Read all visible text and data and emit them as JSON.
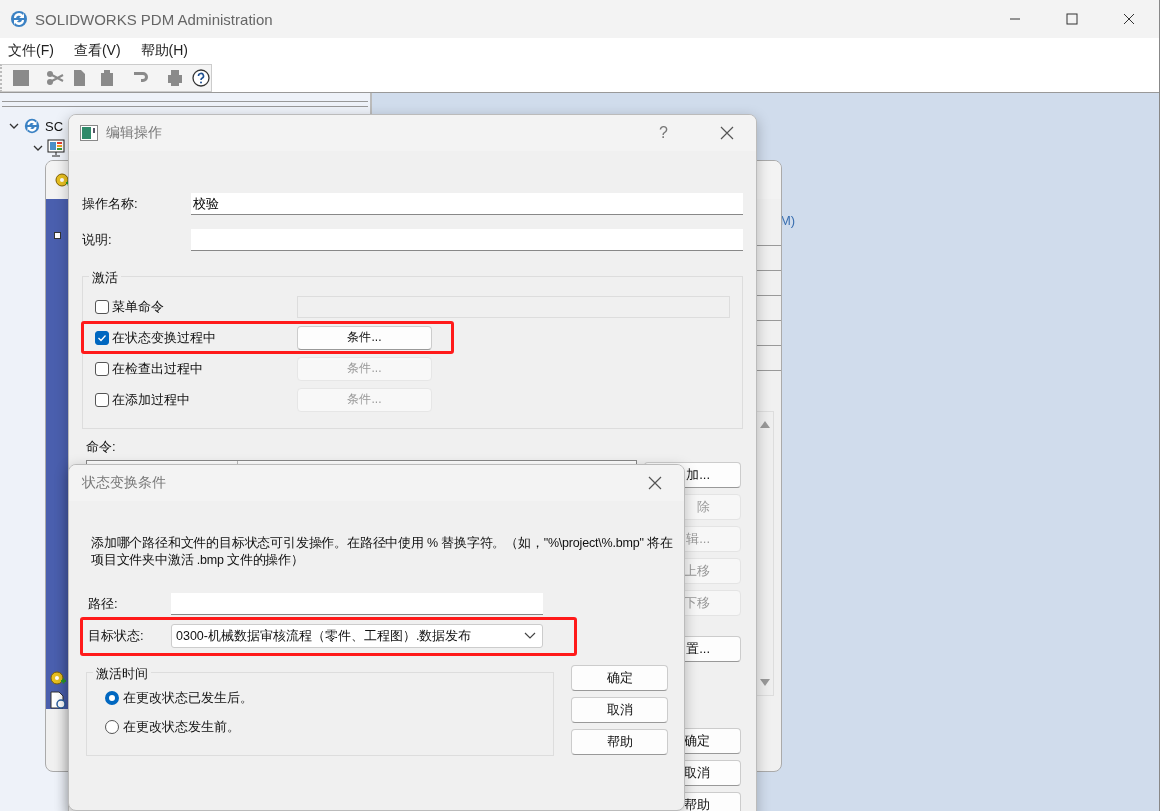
{
  "window": {
    "title": "SOLIDWORKS PDM Administration"
  },
  "menu": [
    "文件(F)",
    "查看(V)",
    "帮助(H)"
  ],
  "toolbar": [
    [
      {
        "kind": "save",
        "disabled": true
      }
    ],
    [
      {
        "kind": "cut",
        "disabled": true
      },
      {
        "kind": "copy",
        "disabled": true
      },
      {
        "kind": "paste",
        "disabled": true
      }
    ],
    [
      {
        "kind": "undo",
        "disabled": true
      }
    ],
    [
      {
        "kind": "print",
        "disabled": true
      },
      {
        "kind": "help",
        "disabled": false
      }
    ]
  ],
  "tree": [
    {
      "kind": "vault",
      "label": "SC",
      "expanded": true,
      "children": [
        {
          "kind": "computer",
          "expanded": true
        }
      ]
    }
  ],
  "background_pane": {
    "fragment": "M)"
  },
  "edit_dialog": {
    "title": "编辑操作",
    "help_mark": "?",
    "fields": [
      {
        "label": "操作名称:",
        "value": "校验"
      },
      {
        "label": "说明:"
      }
    ],
    "activation": {
      "title": "激活",
      "options": [
        {
          "kind": "field",
          "label": "菜单命令",
          "checked": false,
          "highlighted": false
        },
        {
          "kind": "button",
          "label": "在状态变换过程中",
          "checked": true,
          "highlighted": true,
          "button": {
            "label": "条件...",
            "disabled": false
          }
        },
        {
          "kind": "button",
          "label": "在检查出过程中",
          "checked": false,
          "highlighted": false,
          "button": {
            "label": "条件...",
            "disabled": true
          }
        },
        {
          "kind": "button",
          "label": "在添加过程中",
          "checked": false,
          "highlighted": false,
          "button": {
            "label": "条件...",
            "disabled": true
          }
        }
      ]
    },
    "commands_label": "命令:",
    "command_buttons": [
      {
        "label": "加...",
        "disabled": false
      },
      {
        "label": "除",
        "disabled": true
      },
      {
        "label": "辑...",
        "disabled": true
      },
      {
        "label": "上移",
        "disabled": true
      },
      {
        "label": "下移",
        "disabled": true
      },
      {
        "label": "置...",
        "disabled": false
      }
    ],
    "footer_buttons": [
      "确定",
      "取消",
      "帮助"
    ]
  },
  "condition_dialog": {
    "title": "状态变换条件",
    "description": "添加哪个路径和文件的目标状态可引发操作。在路径中使用 % 替换字符。（如，\"%\\project\\%.bmp\" 将在项目文件夹中激活 .bmp 文件的操作）",
    "path_label": "路径:",
    "target_label": "目标状态:",
    "target_value": "0300-机械数据审核流程（零件、工程图）.数据发布",
    "target_highlighted": true,
    "timing": {
      "title": "激活时间",
      "options": [
        {
          "label": "在更改状态已发生后。",
          "selected": true
        },
        {
          "label": "在更改状态发生前。",
          "selected": false
        }
      ]
    },
    "buttons": [
      "确定",
      "取消",
      "帮助"
    ]
  }
}
